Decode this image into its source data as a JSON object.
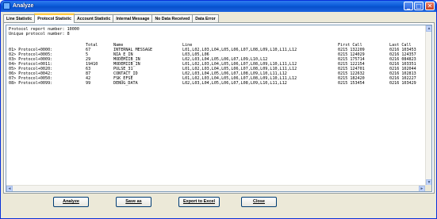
{
  "window": {
    "title": "Analyze"
  },
  "controls": {
    "minimize": "_",
    "maximize": "□",
    "close": "✕"
  },
  "tabs": [
    {
      "label": "Line Statistic",
      "active": false
    },
    {
      "label": "Protocol Statistic",
      "active": true
    },
    {
      "label": "Account Statistic",
      "active": false
    },
    {
      "label": "Internal Message",
      "active": false
    },
    {
      "label": "No Data Received",
      "active": false
    },
    {
      "label": "Data Error",
      "active": false
    }
  ],
  "report": {
    "report_number_line": "Protocol report number: 10000",
    "unique_protocols_line": "Unique protocol number: 8",
    "headers": {
      "total": "Total",
      "name": "Name",
      "line": "Line",
      "first_call": "First Call",
      "last_call": "Last Call"
    },
    "rows": [
      {
        "id": "01> Protocol+0000:",
        "total": "67",
        "name": "INTERNAL MESSAGE",
        "line": "L01,L02,L03,L04,L05,L06,L07,L08,L09,L10,L11,L12",
        "first_call": "0215 132209",
        "last_call": "0216 103453"
      },
      {
        "id": "02> Protocol+0005:",
        "total": "5",
        "name": "NIA_E_IN",
        "line": "L03,L05,L06",
        "first_call": "0215 124029",
        "last_call": "0216 124357"
      },
      {
        "id": "03> Protocol+0009:",
        "total": "29",
        "name": "MODEMIIB_IN",
        "line": "L02,L03,L04,L05,L06,L07,L09,L10,L12",
        "first_call": "0215 175714",
        "last_call": "0216 084823"
      },
      {
        "id": "04> Protocol+0011:",
        "total": "19410",
        "name": "MODEMIIB_IN",
        "line": "L01,L02,L03,L04,L05,L06,L07,L08,L09,L10,L11,L12",
        "first_call": "0215 122154",
        "last_call": "0216 103351"
      },
      {
        "id": "05> Protocol+0020:",
        "total": "63",
        "name": "PULSE_31",
        "line": "L01,L02,L03,L04,L05,L06,L07,L08,L09,L10,L11,L12",
        "first_call": "0215 124701",
        "last_call": "0216 102044"
      },
      {
        "id": "06> Protocol+0042:",
        "total": "87",
        "name": "CONTACT_ID",
        "line": "L02,L03,L04,L05,L06,L07,L08,L09,L10,L11,L12",
        "first_call": "0215 122632",
        "last_call": "0216 102813"
      },
      {
        "id": "07> Protocol+0050:",
        "total": "42",
        "name": "FSK_EFSE",
        "line": "L01,L02,L03,L04,L05,L06,L07,L08,L09,L10,L11,L12",
        "first_call": "0215 182420",
        "last_call": "0216 102227"
      },
      {
        "id": "08> Protocol+0099:",
        "total": "99",
        "name": "DENUG_DATA",
        "line": "L02,L03,L04,L05,L06,L07,L08,L09,L10,L11,L12",
        "first_call": "0215 153454",
        "last_call": "0216 103429"
      }
    ]
  },
  "scroll": {
    "up": "▲",
    "down": "▼",
    "left": "◄",
    "right": "►"
  },
  "buttons": {
    "analyze": "Analyze",
    "save_as": "Save as",
    "export": "Export to Excel",
    "close": "Close"
  },
  "colors": {
    "titlebar": "#0a5ad8",
    "active_tab_accent": "#ffc83c",
    "window_background": "#ece9d8"
  }
}
